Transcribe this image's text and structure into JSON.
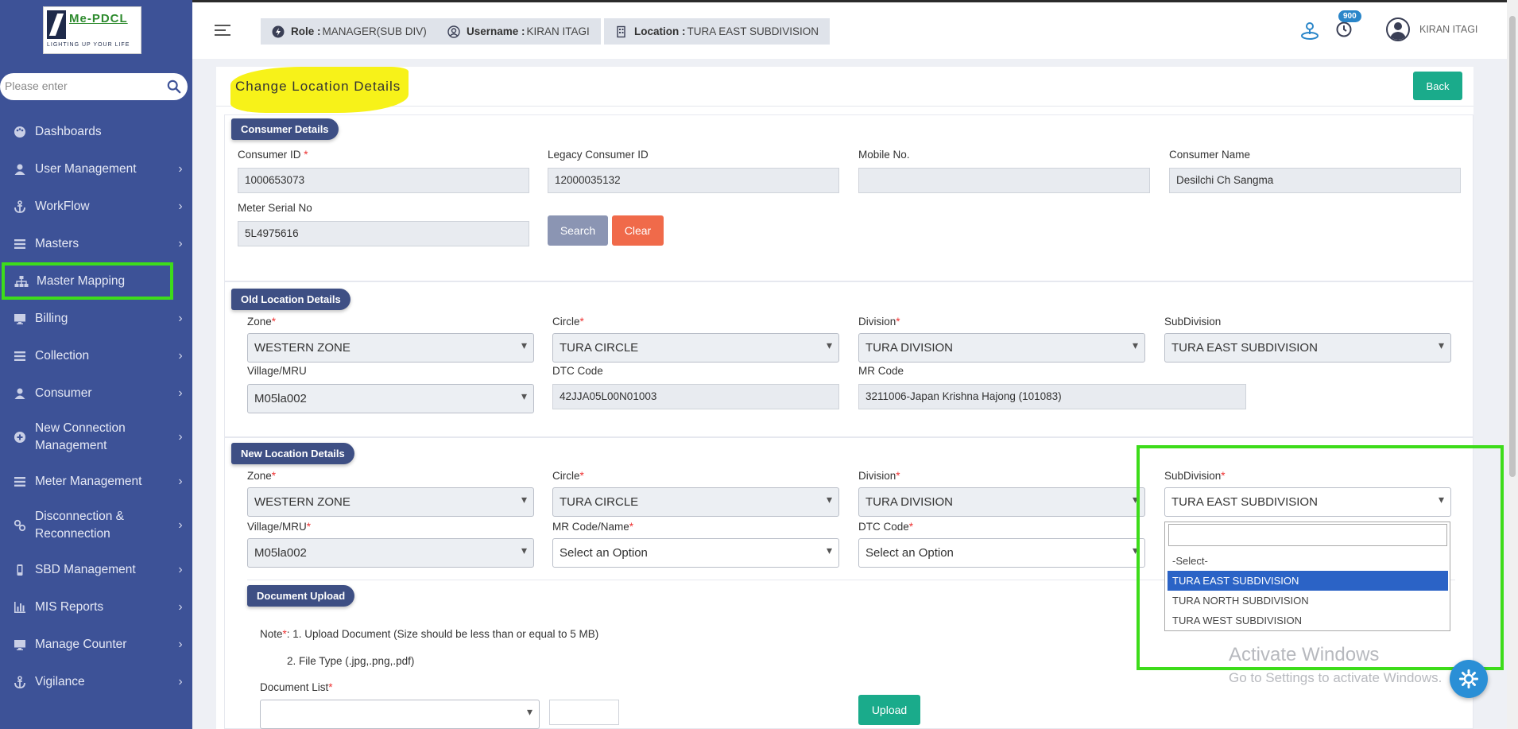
{
  "app": {
    "logo_brand": "Me-PDCL",
    "logo_tagline": "LIGHTING UP YOUR LIFE"
  },
  "sidebar": {
    "search_placeholder": "Please enter",
    "items": [
      {
        "label": "Dashboards",
        "icon": "palette-icon",
        "has_chevron": false
      },
      {
        "label": "User Management",
        "icon": "user-icon",
        "has_chevron": true
      },
      {
        "label": "WorkFlow",
        "icon": "anchor-icon",
        "has_chevron": true
      },
      {
        "label": "Masters",
        "icon": "list-icon",
        "has_chevron": true
      },
      {
        "label": "Master Mapping",
        "icon": "sitemap-icon",
        "has_chevron": false
      },
      {
        "label": "Billing",
        "icon": "monitor-icon",
        "has_chevron": true
      },
      {
        "label": "Collection",
        "icon": "list-icon",
        "has_chevron": true
      },
      {
        "label": "Consumer",
        "icon": "user-icon",
        "has_chevron": true
      },
      {
        "label": "New Connection Management",
        "icon": "plus-circle-icon",
        "has_chevron": true
      },
      {
        "label": "Meter Management",
        "icon": "list-icon",
        "has_chevron": true
      },
      {
        "label": "Disconnection & Reconnection",
        "icon": "link-icon",
        "has_chevron": true
      },
      {
        "label": "SBD Management",
        "icon": "mobile-icon",
        "has_chevron": true
      },
      {
        "label": "MIS Reports",
        "icon": "bar-chart-icon",
        "has_chevron": true
      },
      {
        "label": "Manage Counter",
        "icon": "monitor-icon",
        "has_chevron": true
      },
      {
        "label": "Vigilance",
        "icon": "anchor-icon",
        "has_chevron": true
      }
    ]
  },
  "topbar": {
    "role_label": "Role :",
    "role_value": "MANAGER(SUB DIV)",
    "username_label": "Username :",
    "username_value": "KIRAN ITAGI",
    "location_label": "Location :",
    "location_value": "TURA EAST SUBDIVISION",
    "notification_count": "900",
    "user_name": "KIRAN ITAGI"
  },
  "page": {
    "title": "Change Location Details",
    "back_label": "Back"
  },
  "consumer_details": {
    "section_title": "Consumer Details",
    "consumer_id_label": "Consumer ID",
    "consumer_id_value": "1000653073",
    "legacy_id_label": "Legacy Consumer ID",
    "legacy_id_value": "12000035132",
    "mobile_label": "Mobile No.",
    "mobile_value": "",
    "name_label": "Consumer Name",
    "name_value": "Desilchi  Ch Sangma",
    "meter_label": "Meter Serial No",
    "meter_value": "5L4975616",
    "search_label": "Search",
    "clear_label": "Clear"
  },
  "old_location": {
    "section_title": "Old Location Details",
    "zone_label": "Zone",
    "zone_value": "WESTERN ZONE",
    "circle_label": "Circle",
    "circle_value": "TURA CIRCLE",
    "division_label": "Division",
    "division_value": "TURA DIVISION",
    "subdivision_label": "SubDivision",
    "subdivision_value": "TURA EAST SUBDIVISION",
    "village_label": "Village/MRU",
    "village_value": "M05la002",
    "dtc_label": "DTC Code",
    "dtc_value": "42JJA05L00N01003",
    "mr_label": "MR Code",
    "mr_value": "3211006-Japan Krishna Hajong (101083)"
  },
  "new_location": {
    "section_title": "New Location Details",
    "zone_label": "Zone",
    "zone_value": "WESTERN ZONE",
    "circle_label": "Circle",
    "circle_value": "TURA CIRCLE",
    "division_label": "Division",
    "division_value": "TURA DIVISION",
    "subdivision_label": "SubDivision",
    "subdivision_value": "TURA EAST SUBDIVISION",
    "village_label": "Village/MRU",
    "village_value": "M05la002",
    "mr_label": "MR Code/Name",
    "mr_value": "Select an Option",
    "dtc_label": "DTC Code",
    "dtc_value": "Select an Option",
    "subdivision_options": [
      "-Select-",
      "TURA EAST SUBDIVISION",
      "TURA NORTH SUBDIVISION",
      "TURA WEST SUBDIVISION"
    ],
    "subdivision_search_value": ""
  },
  "document_upload": {
    "section_title": "Document Upload",
    "note_prefix": "Note",
    "note_line1": ": 1. Upload Document (Size should be less than or equal to 5 MB)",
    "note_line2": "2. File Type (.jpg,.png,.pdf)",
    "list_label": "Document List",
    "upload_label": "Upload"
  },
  "os": {
    "watermark_title": "Activate Windows",
    "watermark_sub": "Go to Settings to activate Windows."
  },
  "colors": {
    "sidebar_bg": "#3d5297",
    "accent_teal": "#1aab8b",
    "clear_red": "#f06a4a",
    "search_btn": "#8b95b3",
    "section_tag": "#3e4f84",
    "highlight_green": "#3ddc1a"
  }
}
